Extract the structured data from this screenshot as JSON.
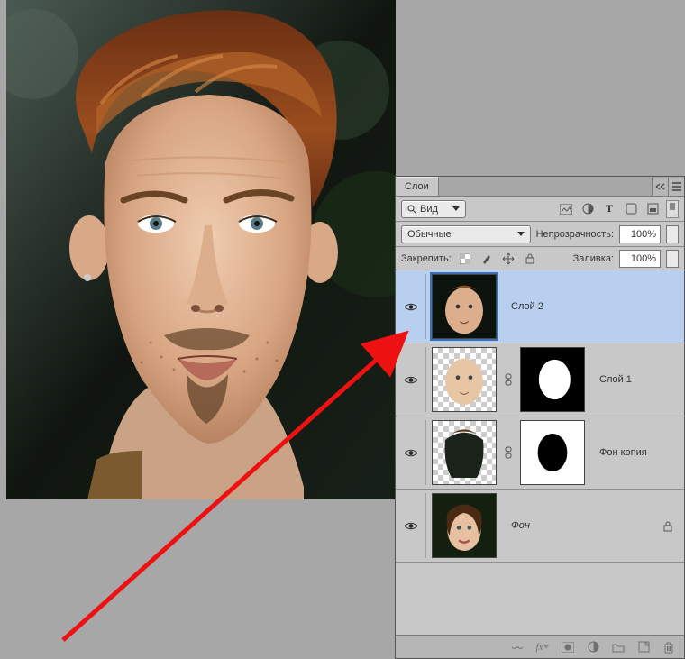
{
  "panel": {
    "tab_label": "Слои",
    "kind_button": "Вид",
    "blend_mode": "Обычные",
    "opacity_label": "Непрозрачность:",
    "opacity_value": "100%",
    "lock_label": "Закрепить:",
    "fill_label": "Заливка:",
    "fill_value": "100%"
  },
  "layers": [
    {
      "name": "Слой 2",
      "has_mask": false,
      "selected": true,
      "locked": false
    },
    {
      "name": "Слой 1",
      "has_mask": true,
      "mask_style": "white-oval-on-black",
      "selected": false,
      "locked": false
    },
    {
      "name": "Фон копия",
      "has_mask": true,
      "mask_style": "black-oval-on-white",
      "selected": false,
      "locked": false
    },
    {
      "name": "Фон",
      "has_mask": false,
      "selected": false,
      "locked": true,
      "italic": true
    }
  ],
  "icons": {
    "search": "search-icon",
    "image_filter": "image-filter-icon",
    "adjust_filter": "adjust-filter-icon",
    "type_filter": "type-filter-icon",
    "shape_filter": "shape-filter-icon",
    "smart_filter": "smart-filter-icon",
    "menu": "panel-menu-icon",
    "collapse": "collapse-icon",
    "lock_transparent": "lock-transparent-icon",
    "lock_paint": "lock-paint-icon",
    "lock_move": "lock-move-icon",
    "lock_all": "lock-all-icon",
    "eye": "eye-icon",
    "link": "link-icon",
    "fx": "fx-icon",
    "mask": "mask-icon",
    "adjustment": "adjustment-icon",
    "group": "group-icon",
    "new": "new-layer-icon",
    "trash": "trash-icon",
    "lock_small": "lock-badge-icon"
  }
}
